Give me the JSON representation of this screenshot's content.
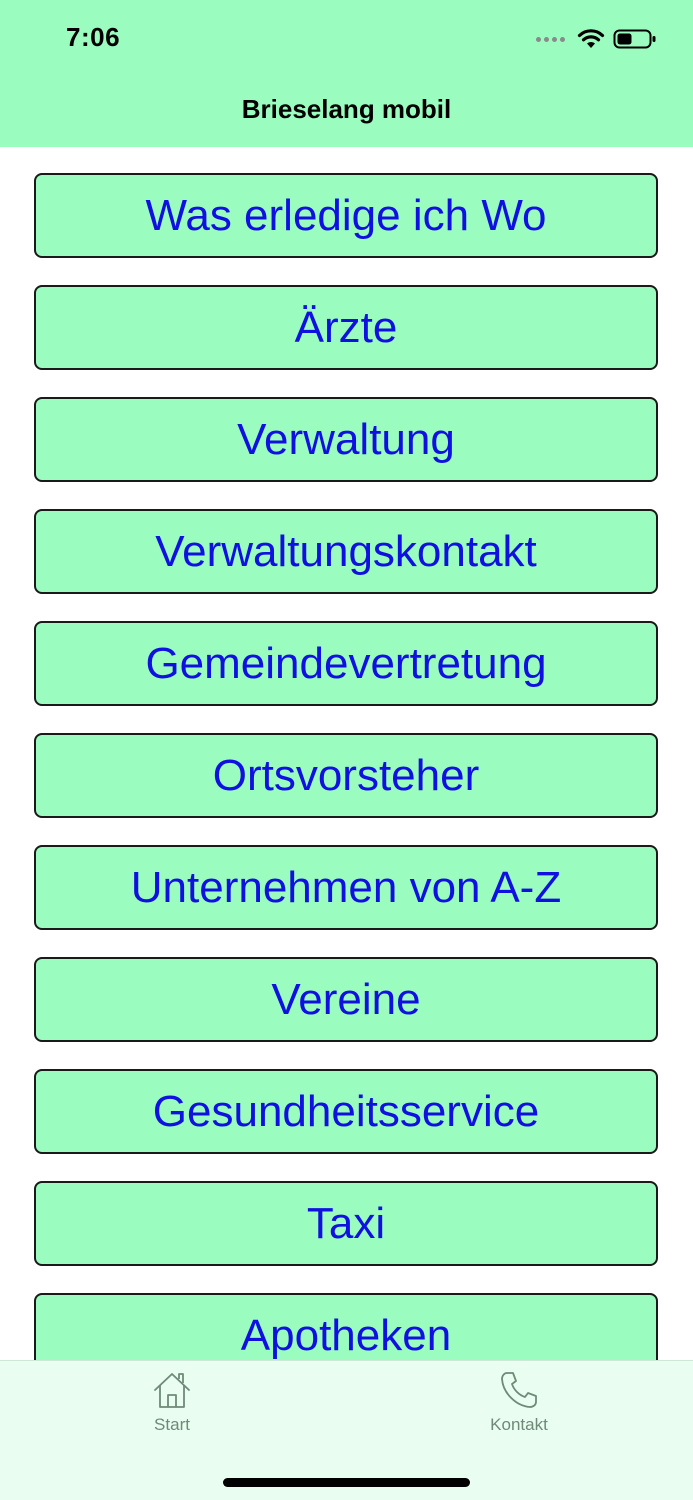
{
  "status_bar": {
    "time": "7:06"
  },
  "nav": {
    "title": "Brieselang mobil"
  },
  "menu": {
    "items": [
      {
        "label": "Was erledige ich Wo"
      },
      {
        "label": "Ärzte"
      },
      {
        "label": "Verwaltung"
      },
      {
        "label": "Verwaltungskontakt"
      },
      {
        "label": "Gemeindevertretung"
      },
      {
        "label": "Ortsvorsteher"
      },
      {
        "label": "Unternehmen von A-Z"
      },
      {
        "label": "Vereine"
      },
      {
        "label": "Gesundheitsservice"
      },
      {
        "label": "Taxi"
      },
      {
        "label": "Apotheken"
      }
    ]
  },
  "tabbar": {
    "tabs": [
      {
        "label": "Start",
        "icon": "house-icon"
      },
      {
        "label": "Kontakt",
        "icon": "phone-icon"
      }
    ]
  },
  "colors": {
    "header_bg": "#9afcbf",
    "button_bg": "#9afcbf",
    "button_text": "#1010e0",
    "tabbar_bg": "#e9fdf0",
    "tab_inactive": "#6e8a78"
  }
}
